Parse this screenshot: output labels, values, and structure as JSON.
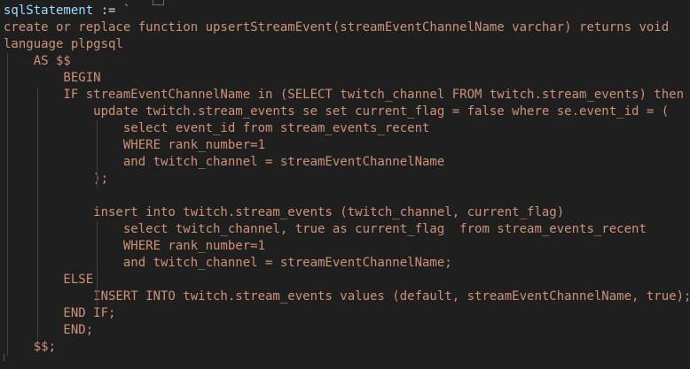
{
  "editor": {
    "lines": [
      {
        "code": "create or replace function upsertStreamEvent(streamEventChannelName varchar) returns void"
      },
      {
        "code": "language plpgsql"
      },
      {
        "code": "    AS $$"
      },
      {
        "code": "        BEGIN"
      },
      {
        "code": "        IF streamEventChannelName in (SELECT twitch_channel FROM twitch.stream_events) then"
      },
      {
        "code": "            update twitch.stream_events se set current_flag = false where se.event_id = ("
      },
      {
        "code": "                select event_id from stream_events_recent"
      },
      {
        "code": "                WHERE rank_number=1"
      },
      {
        "code": "                and twitch_channel = streamEventChannelName"
      },
      {
        "code": "            );"
      },
      {
        "code": ""
      },
      {
        "code": "            insert into twitch.stream_events (twitch_channel, current_flag)"
      },
      {
        "code": "                select twitch_channel, true as current_flag  from stream_events_recent"
      },
      {
        "code": "                WHERE rank_number=1"
      },
      {
        "code": "                and twitch_channel = streamEventChannelName;"
      },
      {
        "code": "        ELSE"
      },
      {
        "code": "            INSERT INTO twitch.stream_events values (default, streamEventChannelName, true);"
      },
      {
        "code": "        END IF;"
      },
      {
        "code": "        END;"
      },
      {
        "code": "    $$;"
      }
    ],
    "first_line": {
      "variable": "sqlStatement",
      "operator": " := ",
      "backtick": "`"
    }
  },
  "colors": {
    "background": "#1f1f1f",
    "string": "#ce9178",
    "variable": "#9cdcfe",
    "operator": "#d4d4d4",
    "indent_guide": "#404040"
  }
}
